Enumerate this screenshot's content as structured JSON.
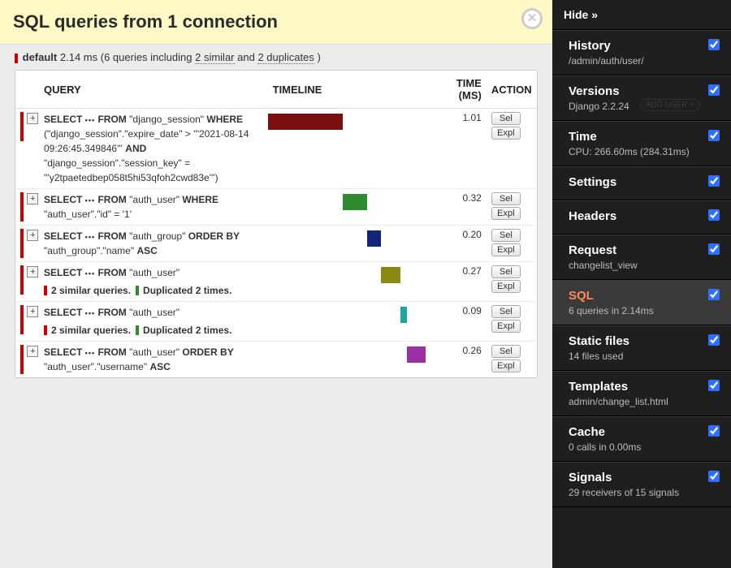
{
  "banner": {
    "title": "SQL queries from 1 connection"
  },
  "summary": {
    "conn_name": "default",
    "total_time": "2.14 ms",
    "query_count_phrase": "(6 queries including ",
    "similar_link": "2 similar",
    "and_word": " and ",
    "dup_link": "2 duplicates",
    "close_paren": " )"
  },
  "table": {
    "headers": {
      "query": "QUERY",
      "timeline": "TIMELINE",
      "time": "TIME (MS)",
      "action": "ACTION"
    },
    "action_labels": {
      "sel": "Sel",
      "expl": "Expl"
    },
    "expand_glyph": "+",
    "rows": [
      {
        "sql_prefix": "SELECT",
        "sql_mid": "FROM",
        "sql_table": "\"django_session\"",
        "sql_tail": " WHERE (\"django_session\".\"expire_date\" > '''2021-08-14 09:26:45.349846''' AND \"django_session\".\"session_key\" = '''y2tpaetedbep058t5hi53qfoh2cwd83e''')",
        "time": "1.01",
        "bar": {
          "left_pct": 0,
          "width_pct": 47,
          "color": "#7a0f0f"
        },
        "notes": []
      },
      {
        "sql_prefix": "SELECT",
        "sql_mid": "FROM",
        "sql_table": "\"auth_user\"",
        "sql_tail": " WHERE \"auth_user\".\"id\" = '1'",
        "time": "0.32",
        "bar": {
          "left_pct": 47,
          "width_pct": 15,
          "color": "#2e8b2e"
        },
        "notes": []
      },
      {
        "sql_prefix": "SELECT",
        "sql_mid": "FROM",
        "sql_table": "\"auth_group\"",
        "sql_tail": " ORDER BY \"auth_group\".\"name\" ASC",
        "time": "0.20",
        "bar": {
          "left_pct": 62,
          "width_pct": 9,
          "color": "#14237a"
        },
        "notes": []
      },
      {
        "sql_prefix": "SELECT",
        "sql_mid": "FROM",
        "sql_table": "\"auth_user\"",
        "sql_tail": "",
        "time": "0.27",
        "bar": {
          "left_pct": 71,
          "width_pct": 12,
          "color": "#8a8a12"
        },
        "notes": [
          {
            "kind": "sim",
            "text": "2 similar queries."
          },
          {
            "kind": "dup",
            "text": "Duplicated 2 times."
          }
        ]
      },
      {
        "sql_prefix": "SELECT",
        "sql_mid": "FROM",
        "sql_table": "\"auth_user\"",
        "sql_tail": "",
        "time": "0.09",
        "bar": {
          "left_pct": 83,
          "width_pct": 4,
          "color": "#1aa6a0"
        },
        "notes": [
          {
            "kind": "sim",
            "text": "2 similar queries."
          },
          {
            "kind": "dup",
            "text": "Duplicated 2 times."
          }
        ]
      },
      {
        "sql_prefix": "SELECT",
        "sql_mid": "FROM",
        "sql_table": "\"auth_user\"",
        "sql_tail": " ORDER BY \"auth_user\".\"username\" ASC",
        "time": "0.26",
        "bar": {
          "left_pct": 87,
          "width_pct": 12,
          "color": "#9b2fa3"
        },
        "notes": []
      }
    ]
  },
  "sidebar": {
    "hide_label": "Hide »",
    "items": [
      {
        "title": "History",
        "sub": "/admin/auth/user/",
        "checked": true,
        "active": false
      },
      {
        "title": "Versions",
        "sub": "Django 2.2.24",
        "checked": true,
        "active": false,
        "ghost": "ADD USER  +"
      },
      {
        "title": "Time",
        "sub": "CPU: 266.60ms (284.31ms)",
        "checked": true,
        "active": false
      },
      {
        "title": "Settings",
        "sub": "",
        "checked": true,
        "active": false
      },
      {
        "title": "Headers",
        "sub": "",
        "checked": true,
        "active": false
      },
      {
        "title": "Request",
        "sub": "changelist_view",
        "checked": true,
        "active": false
      },
      {
        "title": "SQL",
        "sub": "6 queries in 2.14ms",
        "checked": true,
        "active": true
      },
      {
        "title": "Static files",
        "sub": "14 files used",
        "checked": true,
        "active": false
      },
      {
        "title": "Templates",
        "sub": "admin/change_list.html",
        "checked": true,
        "active": false
      },
      {
        "title": "Cache",
        "sub": "0 calls in 0.00ms",
        "checked": true,
        "active": false
      },
      {
        "title": "Signals",
        "sub": "29 receivers of 15 signals",
        "checked": true,
        "active": false
      }
    ]
  }
}
